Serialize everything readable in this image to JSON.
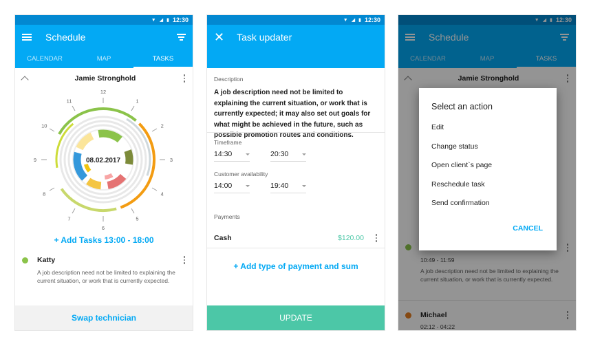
{
  "status_bar": {
    "time": "12:30"
  },
  "screen1": {
    "title": "Schedule",
    "tabs": [
      "CALENDAR",
      "MAP",
      "TASKS"
    ],
    "person": "Jamie Stronghold",
    "clock": {
      "date": "08.02.2017",
      "hours": [
        "12",
        "1",
        "2",
        "3",
        "4",
        "5",
        "6",
        "7",
        "8",
        "9",
        "10",
        "11"
      ]
    },
    "add_tasks": "+ Add Tasks 13:00 - 18:00",
    "task": {
      "name": "Katty",
      "color": "#8bc34a",
      "description": "A job description need not be limited to explaining the current situation, or work that is currently expected."
    },
    "bottom_button": "Swap technician"
  },
  "screen2": {
    "title": "Task updater",
    "description_label": "Description",
    "description": "A job description need not be limited to explaining the current situation, or work that is currently expected; it may also set out goals for what might be achieved in the future, such as possible promotion routes and conditions.",
    "timeframe_label": "Timeframe",
    "timeframe_from": "14:30",
    "timeframe_to": "20:30",
    "availability_label": "Customer availability",
    "availability_from": "14:00",
    "availability_to": "19:40",
    "payments_label": "Payments",
    "payment_name": "Cash",
    "payment_amount": "$120.00",
    "add_payment": "+ Add type of payment and sum",
    "bottom_button": "UPDATE"
  },
  "screen3": {
    "title": "Schedule",
    "tabs": [
      "CALENDAR",
      "MAP",
      "TASKS"
    ],
    "person": "Jamie Stronghold",
    "task1": {
      "time": "10:49 - 11:59",
      "color": "#8bc34a",
      "description": "A job description need not be limited to explaining the current situation, or work that is currently expected."
    },
    "task2": {
      "name": "Michael",
      "time": "02:12 - 04:22",
      "color": "#e67e22"
    },
    "dialog": {
      "title": "Select an action",
      "items": [
        "Edit",
        "Change status",
        "Open client`s page",
        "Reschedule task",
        "Send confirmation"
      ],
      "cancel": "CANCEL"
    }
  },
  "colors": {
    "primary": "#03a9f4",
    "primary_dark": "#0288d1",
    "accent_green": "#4cc7a7"
  }
}
